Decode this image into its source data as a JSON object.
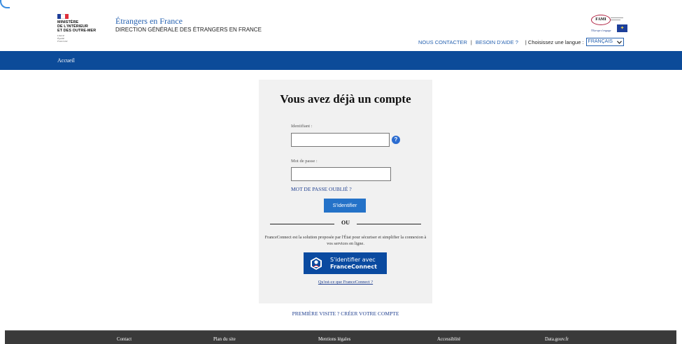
{
  "header": {
    "logo": {
      "lines": [
        "MINISTÈRE",
        "DE L'INTÉRIEUR",
        "ET DES OUTRE-MER"
      ],
      "motto": [
        "Liberté",
        "Égalité",
        "Fraternité"
      ]
    },
    "site_title": "Étrangers en France",
    "site_subtitle": "DIRECTION GÉNÉRALE DES ÉTRANGERS EN FRANCE",
    "fami_logo": {
      "badge_text": "FAMI",
      "eu_text": "l'Europe s'engage"
    },
    "links": {
      "contact": "NOUS CONTACTER",
      "help": "BESOIN D'AIDE ?",
      "lang_label": "| Choisissez une langue :",
      "lang_value": "FRANÇAIS"
    }
  },
  "nav": {
    "home": "Accueil"
  },
  "login": {
    "title": "Vous avez déjà un compte",
    "username_label": "Identifiant :",
    "username_value": "",
    "password_label": "Mot de passe :",
    "password_value": "",
    "forgot": "MOT DE PASSE OUBLIÉ ?",
    "submit": "S'identifier",
    "or": "OU",
    "fc_desc": "FranceConnect est la solution proposée par l'État pour sécuriser et simplifier la connexion à vos services en ligne.",
    "fc_button_line1": "S'identifier avec",
    "fc_button_line2": "FranceConnect",
    "fc_what": "Qu'est-ce que FranceConnect ?"
  },
  "first_visit": "PREMIÈRE VISITE ? CRÉER VOTRE COMPTE",
  "footer": {
    "items": [
      "Contact",
      "Plan du site",
      "Mentions légales",
      "Accessiblité",
      "Data.gouv.fr"
    ]
  },
  "colors": {
    "nav_blue": "#0c4b99",
    "button_blue": "#2472c8",
    "link_blue": "#1f3f8f",
    "footer": "#3a3a3a",
    "card_bg": "#f1f1f1"
  },
  "icons": {
    "help": "question-circle-icon",
    "select_arrow": "chevron-down-icon",
    "franceconnect": "franceconnect-logo-icon"
  }
}
